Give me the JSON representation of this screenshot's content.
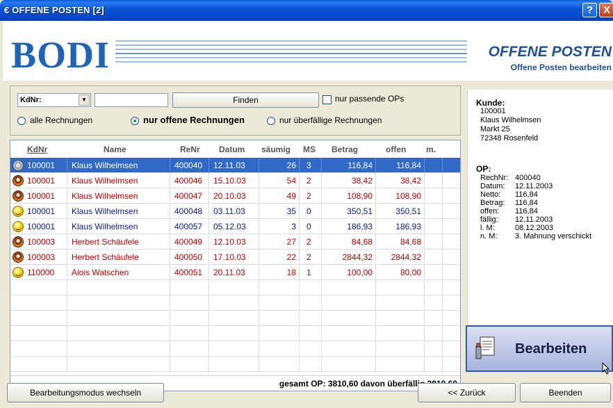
{
  "window": {
    "title": "€ OFFENE POSTEN [2]",
    "help_label": "?",
    "close_label": "X"
  },
  "header": {
    "logo": "BODI",
    "title": "OFFENE POSTEN",
    "subtitle": "Offene Posten bearbeiten"
  },
  "filter": {
    "combo_value": "KdNr:",
    "input_value": "",
    "find_label": "Finden",
    "checkbox_label": "nur passende OPs",
    "radio_all": "alle Rechnungen",
    "radio_open": "nur offene Rechnungen",
    "radio_overdue": "nur überfällige Rechnungen"
  },
  "table": {
    "headers": {
      "kdnr": "KdNr",
      "name": "Name",
      "renr": "ReNr",
      "datum": "Datum",
      "saeumig": "säumig",
      "ms": "MS",
      "betrag": "Betrag",
      "offen": "offen",
      "m": "m."
    },
    "rows": [
      {
        "icon": "gear-icon",
        "kdnr": "100001",
        "name": "Klaus Wilhelmsen",
        "renr": "400040",
        "datum": "12.11.03",
        "saeumig": "26",
        "ms": "3",
        "betrag": "116,84",
        "offen": "116,84",
        "m": ""
      },
      {
        "icon": "alarm-clock-icon",
        "kdnr": "100001",
        "name": "Klaus Wilhelmsen",
        "renr": "400046",
        "datum": "15.10.03",
        "saeumig": "54",
        "ms": "2",
        "betrag": "38,42",
        "offen": "38,42",
        "m": ""
      },
      {
        "icon": "alarm-clock-icon",
        "kdnr": "100001",
        "name": "Klaus Wilhelmsen",
        "renr": "400047",
        "datum": "20.10.03",
        "saeumig": "49",
        "ms": "2",
        "betrag": "108,90",
        "offen": "108,90",
        "m": ""
      },
      {
        "icon": "smiley-icon",
        "kdnr": "100001",
        "name": "Klaus Wilhelmsen",
        "renr": "400048",
        "datum": "03.11.03",
        "saeumig": "35",
        "ms": "0",
        "betrag": "350,51",
        "offen": "350,51",
        "m": ""
      },
      {
        "icon": "smiley-icon",
        "kdnr": "100001",
        "name": "Klaus Wilhelmsen",
        "renr": "400057",
        "datum": "05.12.03",
        "saeumig": "3",
        "ms": "0",
        "betrag": "186,93",
        "offen": "186,93",
        "m": ""
      },
      {
        "icon": "alarm-clock-icon",
        "kdnr": "100003",
        "name": "Herbert Schäufele",
        "renr": "400049",
        "datum": "12.10.03",
        "saeumig": "27",
        "ms": "2",
        "betrag": "84,68",
        "offen": "84,68",
        "m": ""
      },
      {
        "icon": "alarm-clock-icon",
        "kdnr": "100003",
        "name": "Herbert Schäufele",
        "renr": "400050",
        "datum": "17.10.03",
        "saeumig": "22",
        "ms": "2",
        "betrag": "2844,32",
        "offen": "2844,32",
        "m": ""
      },
      {
        "icon": "smiley-icon",
        "kdnr": "110000",
        "name": "Alois Watschen",
        "renr": "400051",
        "datum": "20.11.03",
        "saeumig": "18",
        "ms": "1",
        "betrag": "100,00",
        "offen": "80,00",
        "m": ""
      }
    ],
    "summary": "gesamt OP: 3810,60  davon überfällig 3810,60"
  },
  "info": {
    "kunde_label": "Kunde:",
    "kunde_lines": [
      "100001",
      "Klaus Wilhelmsen",
      "Markt 25",
      "72348 Rosenfeld"
    ],
    "op_label": "OP:",
    "op_lines": [
      {
        "k": "RechNr:",
        "v": "400040"
      },
      {
        "k": "Datum:",
        "v": "12.11.2003"
      },
      {
        "k": "Netto:",
        "v": "116,84"
      },
      {
        "k": "Betrag:",
        "v": "116,84"
      },
      {
        "k": "offen:",
        "v": "116,84"
      },
      {
        "k": "fällig:",
        "v": "12.11.2003"
      },
      {
        "k": "l. M:",
        "v": "08.12.2003"
      },
      {
        "k": "n. M:",
        "v": "3. Mahnung verschickt"
      }
    ]
  },
  "actions": {
    "edit_label": "Bearbeiten",
    "mode_label": "Bearbeitungsmodus wechseln",
    "back_label": "<< Zurück",
    "quit_label": "Beenden"
  }
}
